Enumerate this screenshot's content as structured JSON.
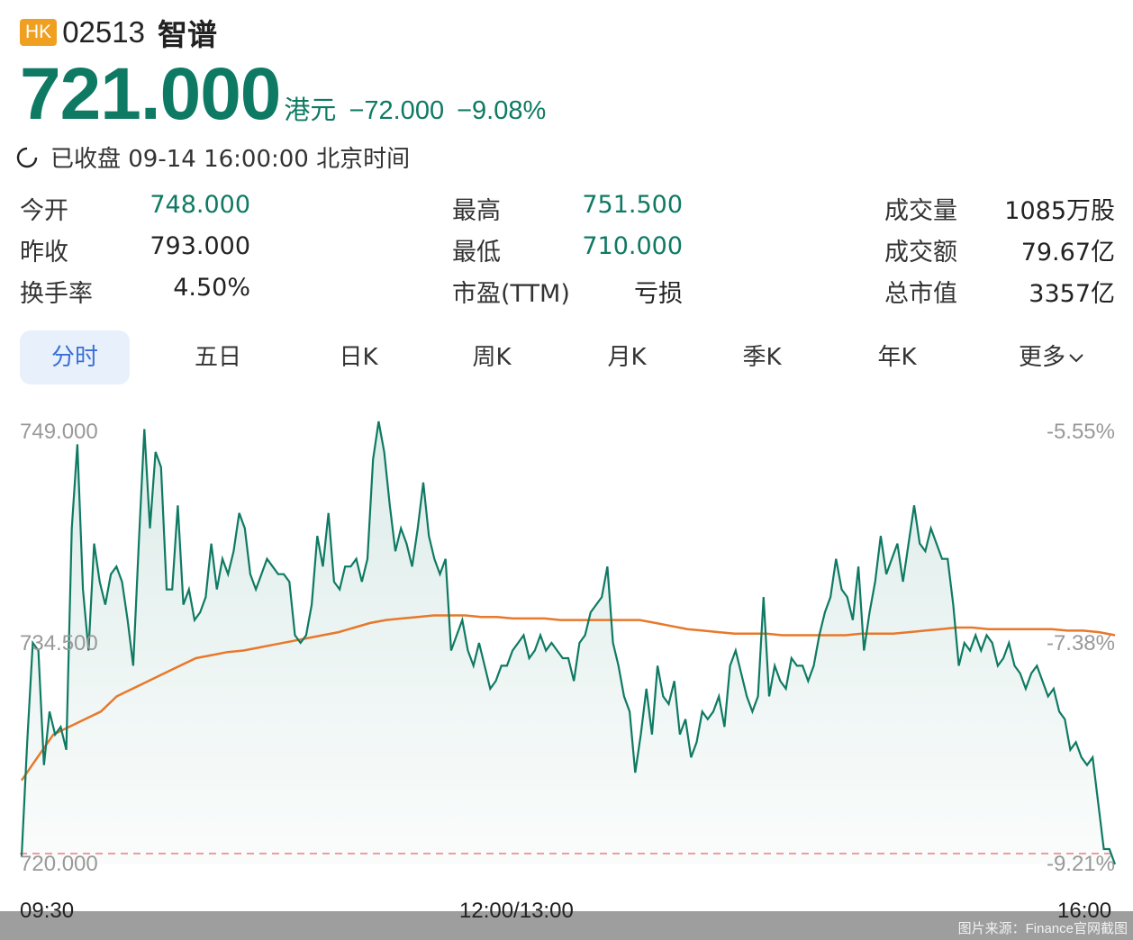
{
  "header": {
    "market_badge": "HK",
    "code": "02513",
    "name": "智谱"
  },
  "quote": {
    "price": "721.000",
    "currency": "港元",
    "change": "−72.000",
    "change_pct": "−9.08%"
  },
  "status": {
    "text": "已收盘 09-14 16:00:00 北京时间"
  },
  "stats": [
    [
      {
        "label": "今开",
        "value": "748.000"
      },
      {
        "label": "最高",
        "value": "751.500"
      },
      {
        "label": "成交量",
        "value": "1085万股"
      }
    ],
    [
      {
        "label": "昨收",
        "value": "793.000"
      },
      {
        "label": "最低",
        "value": "710.000"
      },
      {
        "label": "成交额",
        "value": "79.67亿"
      }
    ],
    [
      {
        "label": "换手率",
        "value": "4.50%"
      },
      {
        "label": "市盈(TTM)",
        "value": "亏损"
      },
      {
        "label": "总市值",
        "value": "3357亿"
      }
    ]
  ],
  "tabs": [
    "分时",
    "五日",
    "日K",
    "周K",
    "月K",
    "季K",
    "年K",
    "更多"
  ],
  "colors": {
    "up_down": "#0f7a63",
    "avg_line": "#e8782a",
    "accent": "#3a6fd8",
    "ref_line": "#f29aa0"
  },
  "chart_data": {
    "type": "line",
    "x_labels": [
      "09:30",
      "12:00/13:00",
      "16:00"
    ],
    "y_left_ticks": [
      "749.000",
      "734.500",
      "720.000"
    ],
    "y_right_ticks": [
      "-5.55%",
      "-7.38%",
      "-9.21%"
    ],
    "ylim": [
      720.0,
      749.0
    ],
    "series": [
      {
        "values": [
          720.5,
          728.0,
          734.5,
          734.0,
          726.5,
          730.0,
          728.5,
          729.0,
          727.5,
          742.0,
          747.5,
          738.0,
          734.0,
          741.0,
          738.5,
          737.0,
          739.0,
          739.5,
          738.5,
          736.0,
          733.0,
          741.0,
          748.5,
          742.0,
          747.0,
          746.0,
          738.0,
          738.0,
          743.5,
          737.0,
          738.0,
          736.0,
          736.5,
          737.5,
          741.0,
          738.0,
          740.0,
          739.0,
          740.5,
          743.0,
          742.0,
          739.0,
          738.0,
          739.0,
          740.0,
          739.5,
          739.0,
          739.0,
          738.5,
          735.0,
          734.5,
          735.0,
          737.0,
          741.5,
          739.5,
          743.0,
          738.5,
          738.0,
          739.5,
          739.5,
          740.0,
          738.5,
          740.0,
          746.5,
          749.0,
          747.0,
          743.5,
          740.5,
          742.0,
          741.0,
          739.5,
          742.0,
          745.0,
          741.5,
          740.0,
          739.0,
          740.0,
          734.0,
          735.0,
          736.0,
          734.0,
          733.0,
          734.5,
          733.0,
          731.5,
          732.0,
          733.0,
          733.0,
          734.0,
          734.5,
          735.0,
          733.5,
          734.0,
          735.0,
          734.0,
          734.5,
          734.0,
          733.5,
          733.5,
          732.0,
          734.5,
          735.0,
          736.5,
          737.0,
          737.5,
          739.5,
          734.5,
          733.0,
          731.0,
          730.0,
          726.0,
          728.5,
          731.5,
          728.5,
          733.0,
          731.0,
          730.5,
          732.0,
          728.5,
          729.5,
          727.0,
          728.0,
          730.0,
          729.5,
          730.0,
          731.0,
          729.0,
          733.0,
          734.0,
          732.5,
          731.0,
          730.0,
          731.0,
          737.5,
          731.0,
          733.0,
          732.0,
          731.5,
          733.5,
          733.0,
          733.0,
          732.0,
          733.0,
          735.0,
          736.5,
          737.5,
          740.0,
          738.0,
          737.5,
          736.0,
          739.5,
          734.0,
          736.5,
          738.5,
          741.5,
          739.0,
          740.0,
          741.0,
          738.5,
          741.0,
          743.5,
          741.0,
          740.5,
          742.0,
          741.0,
          740.0,
          740.0,
          737.0,
          733.0,
          734.5,
          734.0,
          735.0,
          734.0,
          735.0,
          734.5,
          733.0,
          733.5,
          734.5,
          733.0,
          732.5,
          731.5,
          732.5,
          733.0,
          732.0,
          731.0,
          731.5,
          730.0,
          729.5,
          727.5,
          728.0,
          727.0,
          726.5,
          727.0,
          724.0,
          721.0,
          721.0,
          720.0
        ]
      },
      {
        "values": [
          725.5,
          727.0,
          728.5,
          729.0,
          729.5,
          730.0,
          731.0,
          731.5,
          732.0,
          732.5,
          733.0,
          733.5,
          733.7,
          733.9,
          734.0,
          734.2,
          734.4,
          734.6,
          734.8,
          735.0,
          735.2,
          735.5,
          735.8,
          736.0,
          736.1,
          736.2,
          736.3,
          736.3,
          736.3,
          736.2,
          736.2,
          736.1,
          736.1,
          736.1,
          736.0,
          736.0,
          736.0,
          736.0,
          736.0,
          736.0,
          735.8,
          735.6,
          735.4,
          735.3,
          735.2,
          735.1,
          735.1,
          735.1,
          735.0,
          735.0,
          735.0,
          735.0,
          735.0,
          735.1,
          735.1,
          735.1,
          735.2,
          735.3,
          735.4,
          735.5,
          735.5,
          735.4,
          735.4,
          735.4,
          735.4,
          735.4,
          735.3,
          735.3,
          735.2,
          735.0
        ]
      }
    ],
    "grid": false
  },
  "footer": {
    "watermark": "图片来源：Finance官网截图"
  }
}
